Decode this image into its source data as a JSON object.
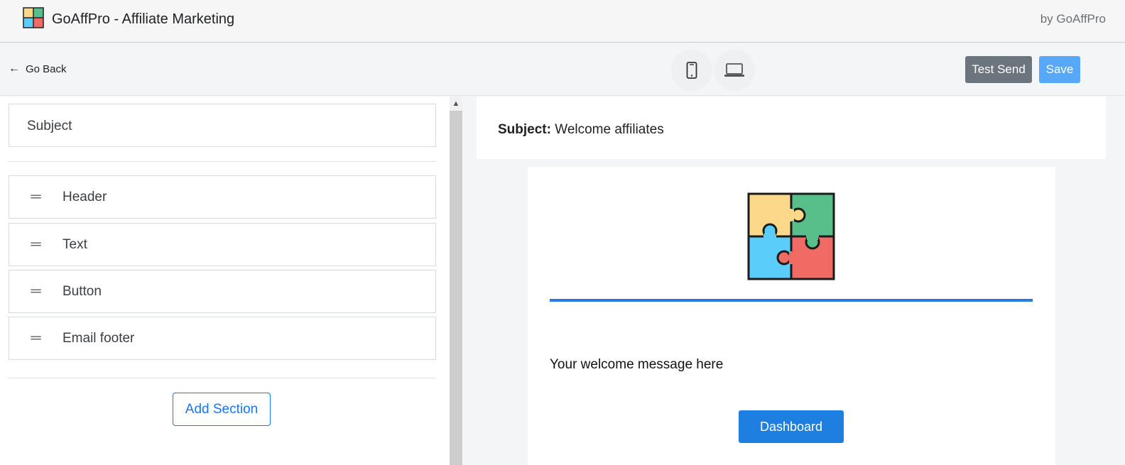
{
  "app": {
    "title": "GoAffPro - Affiliate Marketing",
    "by": "by GoAffPro",
    "logo_icon": "puzzle-icon"
  },
  "toolbar": {
    "go_back_label": "Go Back",
    "mobile_icon": "mobile-phone-icon",
    "desktop_icon": "laptop-icon",
    "test_send_label": "Test Send",
    "save_label": "Save"
  },
  "sidebar": {
    "subject_label": "Subject",
    "sections": [
      {
        "label": "Header"
      },
      {
        "label": "Text"
      },
      {
        "label": "Button"
      },
      {
        "label": "Email footer"
      }
    ],
    "add_section_label": "Add Section"
  },
  "preview": {
    "subject_prefix": "Subject:",
    "subject_value": "Welcome affiliates",
    "welcome_message": "Your welcome message here",
    "button_label": "Dashboard"
  },
  "colors": {
    "primary": "#1e7fe0",
    "save": "#58a8f9",
    "test_send": "#6c757d",
    "puzzle_yellow": "#fcd98a",
    "puzzle_green": "#58bf8b",
    "puzzle_blue": "#5bcdfb",
    "puzzle_red": "#ef6b63"
  }
}
